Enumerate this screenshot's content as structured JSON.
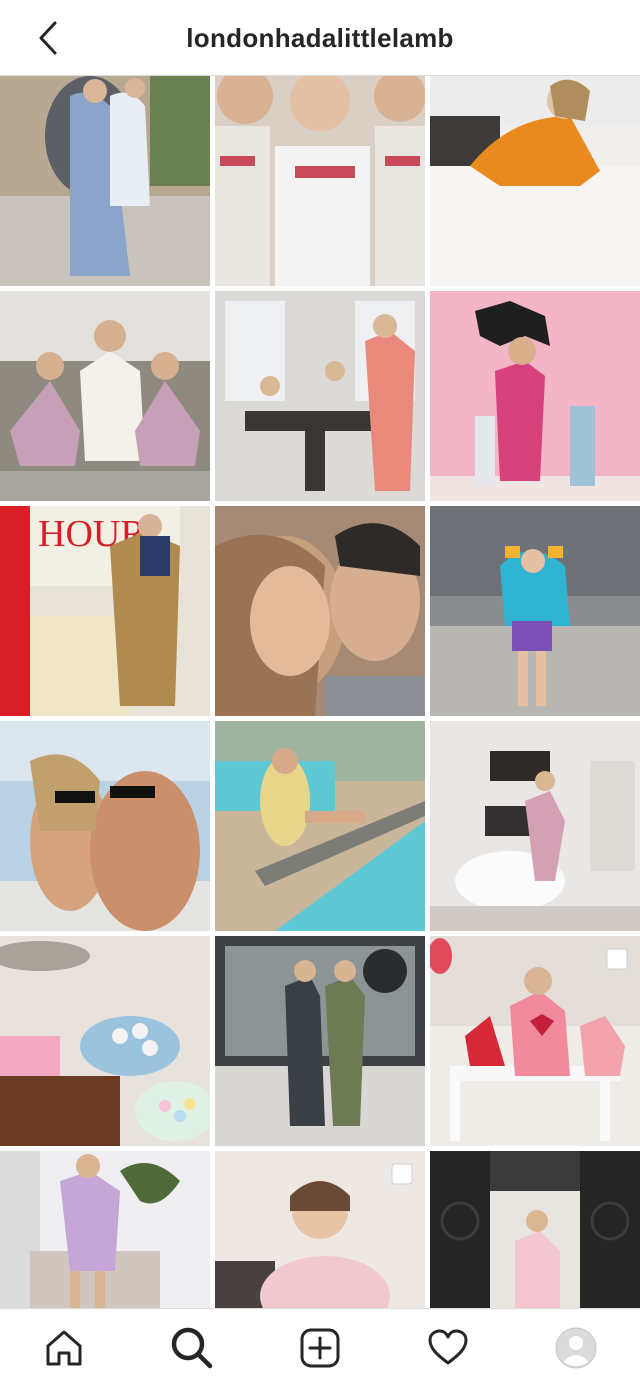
{
  "header": {
    "username": "londonhadalittlelamb",
    "back_icon": "chevron-left-icon"
  },
  "grid": {
    "tiles": [
      {
        "subject": "mother and daughter in embroidered dresses on hanging chair",
        "palette": [
          "#8aa5c9",
          "#c9d6e6",
          "#6a7f52"
        ],
        "multi": false
      },
      {
        "subject": "three girls in embroidered blouses",
        "palette": [
          "#e8e4e0",
          "#c94a5b",
          "#b9a58f"
        ],
        "multi": false
      },
      {
        "subject": "woman in orange sweater at kitchen counter",
        "palette": [
          "#f0efed",
          "#e98a1f",
          "#3c3b3a"
        ],
        "multi": false
      },
      {
        "subject": "mother and daughters in floral dresses on sofa",
        "palette": [
          "#8f8a80",
          "#f4f1ea",
          "#c7a0b8"
        ],
        "multi": false
      },
      {
        "subject": "family at dining table",
        "palette": [
          "#dcdad6",
          "#e98a7d",
          "#3a3633"
        ],
        "multi": false
      },
      {
        "subject": "woman in pink coat with kids at pink wall",
        "palette": [
          "#f4b5c6",
          "#d7417c",
          "#2a2a2a"
        ],
        "multi": false
      },
      {
        "subject": "woman holding HOUR magazine in red office",
        "palette": [
          "#d71f25",
          "#f2efe5",
          "#b08a4e"
        ],
        "multi": false
      },
      {
        "subject": "couple smiling close-up",
        "palette": [
          "#c79f7d",
          "#2e2a28",
          "#8a6a52"
        ],
        "multi": false
      },
      {
        "subject": "child with float and sunglasses by pool",
        "palette": [
          "#8a8d90",
          "#2fb4d1",
          "#e0566d"
        ],
        "multi": false
      },
      {
        "subject": "couple in sunglasses at beach club",
        "palette": [
          "#b9d1e3",
          "#d6a27e",
          "#6e5a4a"
        ],
        "multi": false
      },
      {
        "subject": "woman in yellow swimsuit by pool",
        "palette": [
          "#5fc8d5",
          "#c9b69a",
          "#e7d58a"
        ],
        "multi": false
      },
      {
        "subject": "woman in robe on bathtub",
        "palette": [
          "#e9e6e3",
          "#d4a1b4",
          "#5a5450"
        ],
        "multi": false
      },
      {
        "subject": "candy and pretzels platter",
        "palette": [
          "#e8e2dc",
          "#6a3b22",
          "#f2a9c1"
        ],
        "multi": false
      },
      {
        "subject": "couple in front of macaron shop",
        "palette": [
          "#cfd3d1",
          "#3a3f45",
          "#6d7a54"
        ],
        "multi": false
      },
      {
        "subject": "girls at table with hearts",
        "palette": [
          "#f0ece8",
          "#e04a5b",
          "#d9d0c8"
        ],
        "multi": true
      },
      {
        "subject": "woman in lavender dress on ottoman",
        "palette": [
          "#efeef0",
          "#c6a6d6",
          "#4f6b3a"
        ],
        "multi": false
      },
      {
        "subject": "baby in tutu eating treats",
        "palette": [
          "#ede8e4",
          "#f2c9cf",
          "#6a4a34"
        ],
        "multi": true
      },
      {
        "subject": "woman in pink dress at iron doors",
        "palette": [
          "#252525",
          "#f3c6d1",
          "#e8e4df"
        ],
        "multi": false
      },
      {
        "subject": "partial tile",
        "palette": [
          "#e5e0dc",
          "#c9a58a",
          "#6a5a52"
        ],
        "multi": false
      },
      {
        "subject": "partial tile",
        "palette": [
          "#e8ecef",
          "#9aa3ab",
          "#c9cfd4"
        ],
        "multi": false
      },
      {
        "subject": "partial tile",
        "palette": [
          "#ece9e7",
          "#b8a79c",
          "#d6cfc8"
        ],
        "multi": false
      }
    ]
  },
  "navbar": {
    "items": [
      "home-icon",
      "search-icon",
      "new-post-icon",
      "activity-heart-icon",
      "profile-avatar"
    ],
    "active": "search-icon"
  },
  "colors": {
    "text": "#262626",
    "border": "#dbdbdb",
    "background": "#ffffff"
  }
}
